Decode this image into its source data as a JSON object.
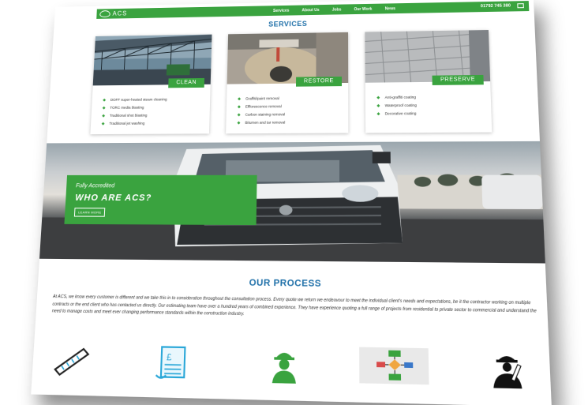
{
  "nav": {
    "logo_text": "ACS",
    "items": [
      "Services",
      "About Us",
      "Jobs",
      "Our Work",
      "News"
    ],
    "phone": "01792 745 380"
  },
  "services": {
    "heading": "SERVICES",
    "cards": [
      {
        "tag": "CLEAN",
        "items": [
          "DOFF super-heated steam cleaning",
          "TORC media blasting",
          "Traditional shot blasting",
          "Traditional jet washing"
        ]
      },
      {
        "tag": "RESTORE",
        "items": [
          "Graffiti/paint removal",
          "Efflorescence removal",
          "Carbon staining removal",
          "Bitumen and tar removal"
        ]
      },
      {
        "tag": "PRESERVE",
        "items": [
          "Anti-graffiti coating",
          "Waterproof coating",
          "Decorative coating"
        ]
      }
    ]
  },
  "hero": {
    "kicker": "Fully Accredited",
    "title": "WHO ARE ACS?",
    "button": "LEARN MORE"
  },
  "process": {
    "heading": "OUR PROCESS",
    "text": "At ACS, we know every customer is different and we take this in to consideration throughout the consultation process. Every quote we return we endeavour to meet the individual client's needs and expectations, be it the contractor working on multiple contracts or the end client who has contacted us directly. Our estimating team have over a hundred years of combined experience. They have experience quoting a full range of projects from residential to private sector to commercial and understand the need to manage costs and meet ever changing performance standards within the construction industry."
  },
  "colors": {
    "brand_green": "#3aa33f",
    "heading_blue": "#1e6fa8",
    "icon_blue": "#2aa7d8"
  },
  "icons": [
    "ruler-icon",
    "pound-invoice-icon",
    "worker-icon",
    "flowchart-icon",
    "engineer-icon"
  ]
}
